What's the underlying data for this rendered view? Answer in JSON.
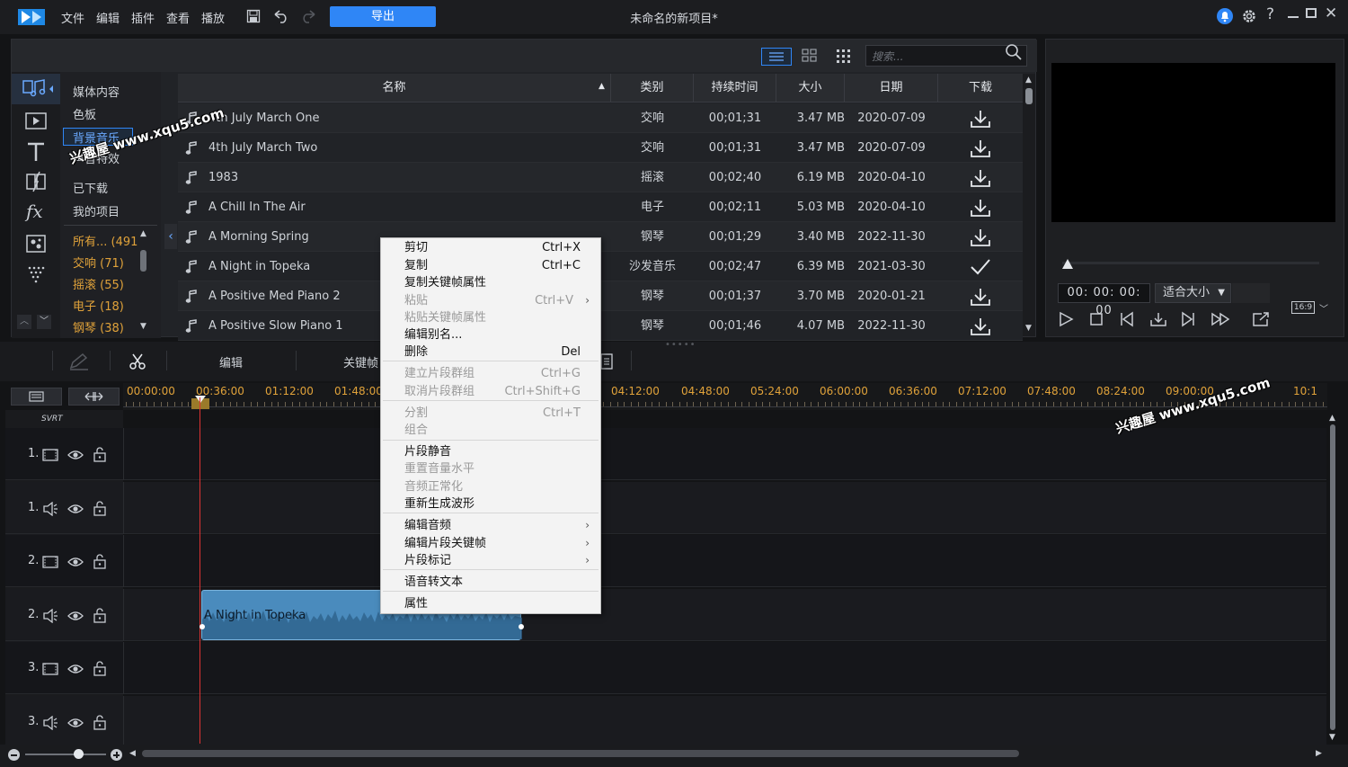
{
  "menubar": {
    "items": [
      "文件",
      "编辑",
      "插件",
      "查看",
      "播放"
    ],
    "export_label": "导出",
    "project_title": "未命名的新项目*"
  },
  "library": {
    "search_placeholder": "搜索...",
    "categories": [
      "媒体内容",
      "色板",
      "背景音乐",
      "声音特效",
      "已下载",
      "我的项目"
    ],
    "genres": [
      "所有... (491",
      "交响 (71)",
      "摇滚 (55)",
      "电子 (18)",
      "钢琴 (38)"
    ],
    "columns": [
      "名称",
      "类别",
      "持续时间",
      "大小",
      "日期",
      "下载"
    ],
    "rows": [
      {
        "name": "4th July March One",
        "type": "交响",
        "duration": "00;01;31",
        "size": "3.47 MB",
        "date": "2020-07-09",
        "downloaded": false
      },
      {
        "name": "4th July March Two",
        "type": "交响",
        "duration": "00;01;31",
        "size": "3.47 MB",
        "date": "2020-07-09",
        "downloaded": false
      },
      {
        "name": "1983",
        "type": "摇滚",
        "duration": "00;02;40",
        "size": "6.19 MB",
        "date": "2020-04-10",
        "downloaded": false
      },
      {
        "name": "A Chill In The Air",
        "type": "电子",
        "duration": "00;02;11",
        "size": "5.03 MB",
        "date": "2020-04-10",
        "downloaded": false
      },
      {
        "name": "A Morning Spring",
        "type": "钢琴",
        "duration": "00;01;29",
        "size": "3.40 MB",
        "date": "2022-11-30",
        "downloaded": false
      },
      {
        "name": "A Night in Topeka",
        "type": "沙发音乐",
        "duration": "00;02;47",
        "size": "6.39 MB",
        "date": "2021-03-30",
        "downloaded": true
      },
      {
        "name": "A Positive Med Piano 2",
        "type": "钢琴",
        "duration": "00;01;37",
        "size": "3.70 MB",
        "date": "2020-01-21",
        "downloaded": false
      },
      {
        "name": "A Positive Slow Piano 1",
        "type": "钢琴",
        "duration": "00;01;46",
        "size": "4.07 MB",
        "date": "2022-11-30",
        "downloaded": false
      }
    ]
  },
  "preview": {
    "timecode": "00: 00: 00: 00",
    "fit": "适合大小",
    "aspect": "16:9"
  },
  "edit_toolbar": {
    "edit": "编辑",
    "keyframe": "关键帧"
  },
  "timeline": {
    "ticks": [
      "00:00:00",
      "00:36:00",
      "01:12:00",
      "01:48:00",
      "04:12:00",
      "04:48:00",
      "05:24:00",
      "06:00:00",
      "06:36:00",
      "07:12:00",
      "07:48:00",
      "08:24:00",
      "09:00:00",
      "10:1"
    ],
    "svrt": "SVRT",
    "tracks": [
      "1.",
      "1.",
      "2.",
      "2.",
      "3.",
      "3."
    ],
    "clip_name": "A Night in Topeka"
  },
  "context_menu": {
    "items": [
      {
        "label": "剪切",
        "shortcut": "Ctrl+X"
      },
      {
        "label": "复制",
        "shortcut": "Ctrl+C"
      },
      {
        "label": "复制关键帧属性",
        "shortcut": ""
      },
      {
        "label": "粘贴",
        "shortcut": "Ctrl+V"
      },
      {
        "label": "粘贴关键帧属性",
        "shortcut": ""
      },
      {
        "label": "编辑别名...",
        "shortcut": ""
      },
      {
        "label": "删除",
        "shortcut": "Del"
      },
      {
        "label": "建立片段群组",
        "shortcut": "Ctrl+G"
      },
      {
        "label": "取消片段群组",
        "shortcut": "Ctrl+Shift+G"
      },
      {
        "label": "分割",
        "shortcut": "Ctrl+T"
      },
      {
        "label": "组合",
        "shortcut": ""
      },
      {
        "label": "片段静音",
        "shortcut": ""
      },
      {
        "label": "重置音量水平",
        "shortcut": ""
      },
      {
        "label": "音频正常化",
        "shortcut": ""
      },
      {
        "label": "重新生成波形",
        "shortcut": ""
      },
      {
        "label": "编辑音频",
        "shortcut": ""
      },
      {
        "label": "编辑片段关键帧",
        "shortcut": ""
      },
      {
        "label": "片段标记",
        "shortcut": ""
      },
      {
        "label": "语音转文本",
        "shortcut": ""
      },
      {
        "label": "属性",
        "shortcut": ""
      }
    ]
  },
  "watermark": "兴趣屋 www.xqu5.com",
  "colors": {
    "accent": "#2f86f6",
    "highlight": "#e0a23a",
    "playhead": "#dd3333",
    "clip": "#4a8bbd"
  }
}
